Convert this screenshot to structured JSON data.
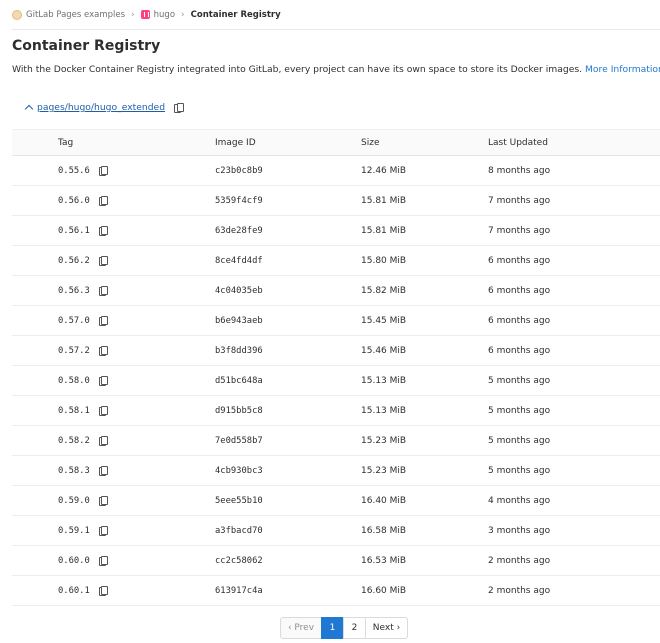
{
  "breadcrumb": {
    "group": "GitLab Pages examples",
    "project": "hugo",
    "current": "Container Registry"
  },
  "page": {
    "title": "Container Registry",
    "description": "With the Docker Container Registry integrated into GitLab, every project can have its own space to store its Docker images.",
    "more_info": "More Information"
  },
  "repository": {
    "path": "pages/hugo/hugo_extended"
  },
  "table": {
    "headers": [
      "Tag",
      "Image ID",
      "Size",
      "Last Updated"
    ],
    "rows": [
      {
        "tag": "0.55.6",
        "image_id": "c23b0c8b9",
        "size": "12.46 MiB",
        "updated": "8 months ago"
      },
      {
        "tag": "0.56.0",
        "image_id": "5359f4cf9",
        "size": "15.81 MiB",
        "updated": "7 months ago"
      },
      {
        "tag": "0.56.1",
        "image_id": "63de28fe9",
        "size": "15.81 MiB",
        "updated": "7 months ago"
      },
      {
        "tag": "0.56.2",
        "image_id": "8ce4fd4df",
        "size": "15.80 MiB",
        "updated": "6 months ago"
      },
      {
        "tag": "0.56.3",
        "image_id": "4c04035eb",
        "size": "15.82 MiB",
        "updated": "6 months ago"
      },
      {
        "tag": "0.57.0",
        "image_id": "b6e943aeb",
        "size": "15.45 MiB",
        "updated": "6 months ago"
      },
      {
        "tag": "0.57.2",
        "image_id": "b3f8dd396",
        "size": "15.46 MiB",
        "updated": "6 months ago"
      },
      {
        "tag": "0.58.0",
        "image_id": "d51bc648a",
        "size": "15.13 MiB",
        "updated": "5 months ago"
      },
      {
        "tag": "0.58.1",
        "image_id": "d915bb5c8",
        "size": "15.13 MiB",
        "updated": "5 months ago"
      },
      {
        "tag": "0.58.2",
        "image_id": "7e0d558b7",
        "size": "15.23 MiB",
        "updated": "5 months ago"
      },
      {
        "tag": "0.58.3",
        "image_id": "4cb930bc3",
        "size": "15.23 MiB",
        "updated": "5 months ago"
      },
      {
        "tag": "0.59.0",
        "image_id": "5eee55b10",
        "size": "16.40 MiB",
        "updated": "4 months ago"
      },
      {
        "tag": "0.59.1",
        "image_id": "a3fbacd70",
        "size": "16.58 MiB",
        "updated": "3 months ago"
      },
      {
        "tag": "0.60.0",
        "image_id": "cc2c58062",
        "size": "16.53 MiB",
        "updated": "2 months ago"
      },
      {
        "tag": "0.60.1",
        "image_id": "613917c4a",
        "size": "16.60 MiB",
        "updated": "2 months ago"
      }
    ]
  },
  "pagination": {
    "prev": "‹ Prev",
    "pages": [
      "1",
      "2"
    ],
    "active": "1",
    "next": "Next ›"
  },
  "icons": {
    "copy": "copy-icon",
    "chevron": "chevron-up-icon"
  },
  "colors": {
    "link": "#1f78d1",
    "active_page": "#1f78d1"
  }
}
